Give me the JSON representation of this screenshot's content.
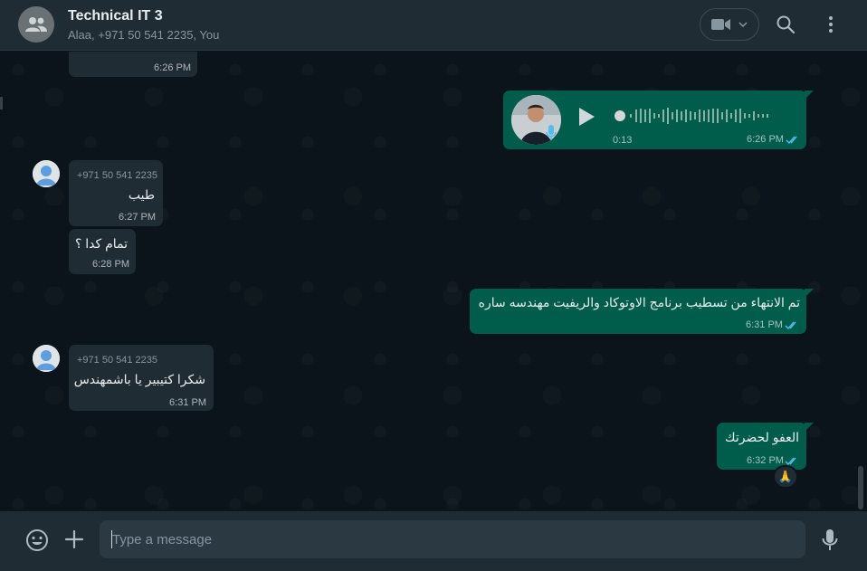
{
  "header": {
    "title": "Technical IT 3",
    "subtitle": "Alaa, +971 50 541 2235, You"
  },
  "messages": {
    "m0": {
      "time": "6:26 PM"
    },
    "m1": {
      "duration": "0:13",
      "time": "6:26 PM"
    },
    "m2": {
      "sender": "+971 50 541 2235",
      "text": "طيب",
      "time": "6:27 PM"
    },
    "m3": {
      "text": "تمام كدا ؟",
      "time": "6:28 PM"
    },
    "m4": {
      "text": "تم الانتهاء من تسطيب برنامج الاوتوكاد والريفيت مهندسه ساره",
      "time": "6:31 PM"
    },
    "m5": {
      "sender": "+971 50 541 2235",
      "text": "شكرا كتيبير يا باشمهندس",
      "time": "6:31 PM"
    },
    "m6": {
      "text": "العفو لحضرتك",
      "time": "6:32 PM",
      "reaction": "🙏"
    }
  },
  "composer": {
    "placeholder": "Type a message"
  },
  "colors": {
    "incoming": "#202c33",
    "outgoing": "#005c4b",
    "read_ticks": "#53bdeb"
  }
}
